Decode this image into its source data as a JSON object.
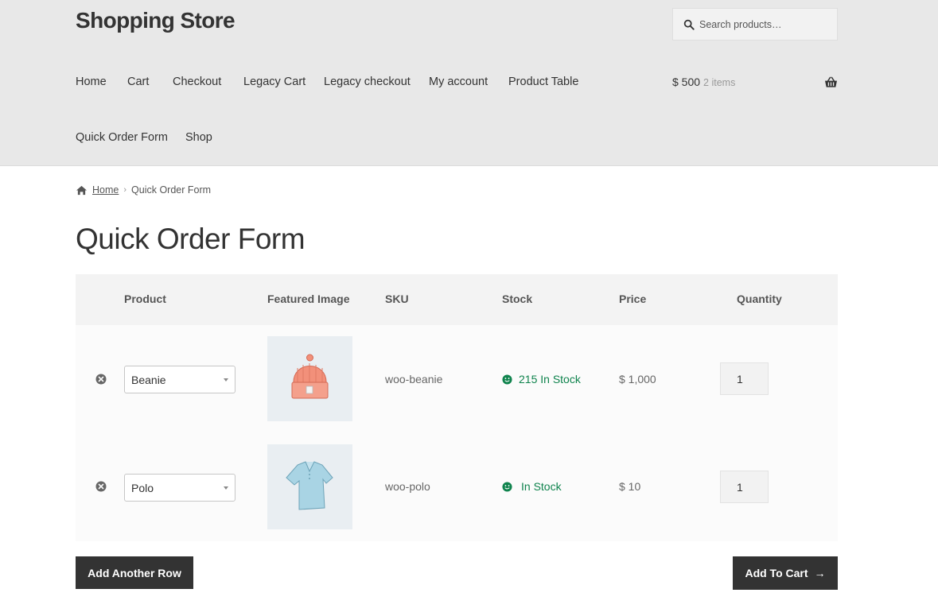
{
  "header": {
    "site_title": "Shopping Store",
    "search_placeholder": "Search products…",
    "nav": [
      "Home",
      "Cart",
      "Checkout",
      "Legacy Cart",
      "Legacy checkout",
      "My account",
      "Product Table",
      "Quick Order Form",
      "Shop"
    ],
    "cart": {
      "total": "$ 500",
      "count": "2 items"
    }
  },
  "breadcrumb": {
    "home": "Home",
    "current": "Quick Order Form"
  },
  "page_title": "Quick Order Form",
  "table": {
    "columns": [
      "Product",
      "Featured Image",
      "SKU",
      "Stock",
      "Price",
      "Quantity"
    ],
    "rows": [
      {
        "product": "Beanie",
        "sku": "woo-beanie",
        "stock": "215 In Stock",
        "price": "$ 1,000",
        "quantity": "1",
        "image": "beanie-image"
      },
      {
        "product": "Polo",
        "sku": "woo-polo",
        "stock": "In Stock",
        "price": "$ 10",
        "quantity": "1",
        "image": "polo-image"
      }
    ]
  },
  "buttons": {
    "add_row": "Add Another Row",
    "add_to_cart": "Add To Cart",
    "add_to_cart_icon": "→"
  },
  "colors": {
    "header_bg": "#e8e8e8",
    "button_bg": "#333333",
    "stock_green": "#0f834d"
  }
}
